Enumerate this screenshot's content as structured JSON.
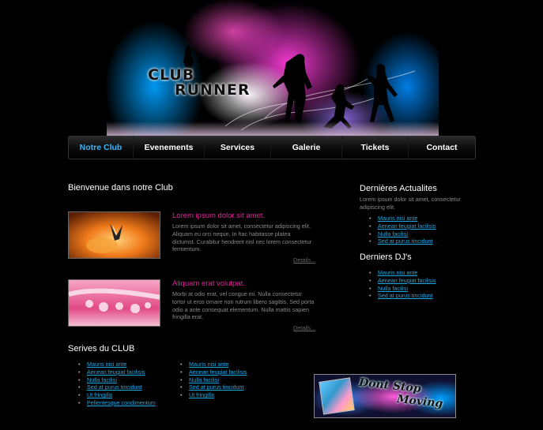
{
  "header": {
    "logo_line1": "CLUB",
    "logo_line2": "RUNNER"
  },
  "nav": {
    "items": [
      "Notre Club",
      "Evenements",
      "Services",
      "Galerie",
      "Tickets",
      "Contact"
    ],
    "active_index": 0,
    "active_color": "#38b6ff"
  },
  "welcome": {
    "heading": "Bienvenue dans notre Club"
  },
  "articles": [
    {
      "title": "Lorem ipsum dolor sit amet.",
      "body": "Lorem ipsum dolor sit amet, consectetur adipiscing elit. Aliquam eu orci neque. In hac habitasse platea dictumst. Curabitur hendrerit nisl nec lorem consectetur fermentum.",
      "link": "Details..."
    },
    {
      "title": "Aliquam erat volutpat.",
      "body": "Morbi at odio erat, vel congue mi. Nulla consectetur tortor ut eros ornare non rutrum libero sagittis. Sed porta odio a ante consequat elementum. Nulla mattis sapien fringilla erat.",
      "link": "Details..."
    }
  ],
  "services": {
    "heading": "Serives du CLUB",
    "col1": [
      "Mauris nisi ante",
      "Aenean feugiat facilisis",
      "Nulla facilisi",
      "Sed at purus tincidunt",
      "Ut fringilla",
      "Pellentesque condimentum"
    ],
    "col2": [
      "Mauris nisi ante",
      "Aenean feugiat facilisis",
      "Nulla facilisi",
      "Sed at purus tincidunt",
      "Ut fringilla"
    ]
  },
  "news": {
    "heading": "Dernières Actualites",
    "intro": "Lorem ipsum dolor sit amet, consectetur adipiscing elit.",
    "links": [
      "Mauris nisi ante",
      "Aenean feugiat facilisis",
      "Nulla facilisi",
      "Sed at purus tincidunt"
    ]
  },
  "djs": {
    "heading": "Derniers DJ's",
    "links": [
      "Mauris nisi ante",
      "Aenean feugiat facilisis",
      "Nulla facilisi",
      "Sed at purus tincidunt"
    ]
  },
  "ad": {
    "line1": "Dont Stop",
    "line2": "Moving"
  },
  "colors": {
    "background": "#000000",
    "article_title": "#e0229a",
    "link": "#1ea8e5",
    "body_text": "#8a8a8a"
  }
}
